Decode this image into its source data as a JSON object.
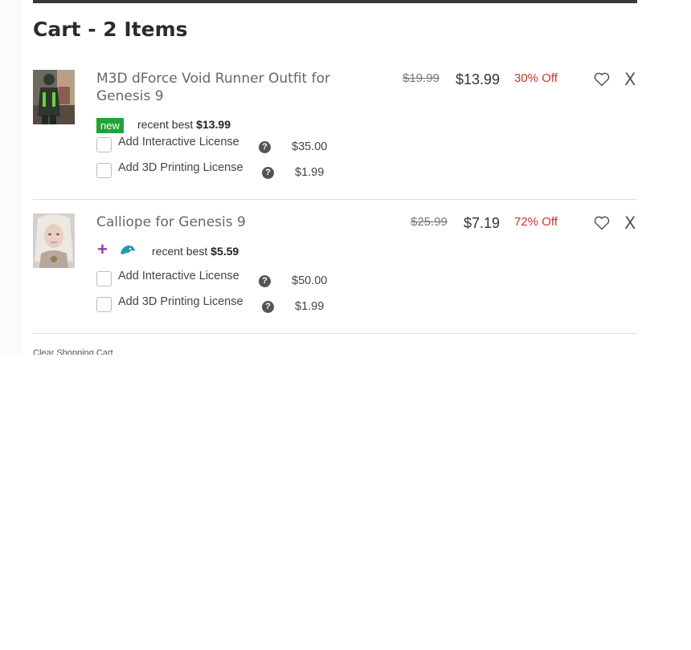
{
  "cart": {
    "title": "Cart - 2 Items",
    "clear_label": "Clear Shopping Cart"
  },
  "items": [
    {
      "name": "M3D dForce Void Runner Outfit for Genesis 9",
      "old_price": "$19.99",
      "price": "$13.99",
      "discount": "30% Off",
      "badge": "new",
      "recent_best_label": "recent best",
      "recent_best_price": "$13.99",
      "licenses": [
        {
          "label": "Add Interactive License",
          "price": "$35.00",
          "checked": false
        },
        {
          "label": "Add 3D Printing License",
          "price": "$1.99",
          "checked": false
        }
      ],
      "thumbnail": "sci-fi-outfit-figure"
    },
    {
      "name": "Calliope for Genesis 9",
      "old_price": "$25.99",
      "price": "$7.19",
      "discount": "72% Off",
      "badge_icons": [
        "plus-icon",
        "published-artist-icon"
      ],
      "recent_best_label": "recent best",
      "recent_best_price": "$5.59",
      "licenses": [
        {
          "label": "Add Interactive License",
          "price": "$50.00",
          "checked": false
        },
        {
          "label": "Add 3D Printing License",
          "price": "$1.99",
          "checked": false
        }
      ],
      "thumbnail": "white-haired-female-figure"
    }
  ],
  "icons": {
    "wishlist": "heart-icon",
    "remove": "close-icon",
    "help": "question-icon"
  },
  "colors": {
    "discount": "#c0392b",
    "new_badge": "#22a336",
    "plus_accent": "#8e3fb0",
    "pa_accent": "#1e9bb0",
    "top_bar": "#343a40"
  }
}
